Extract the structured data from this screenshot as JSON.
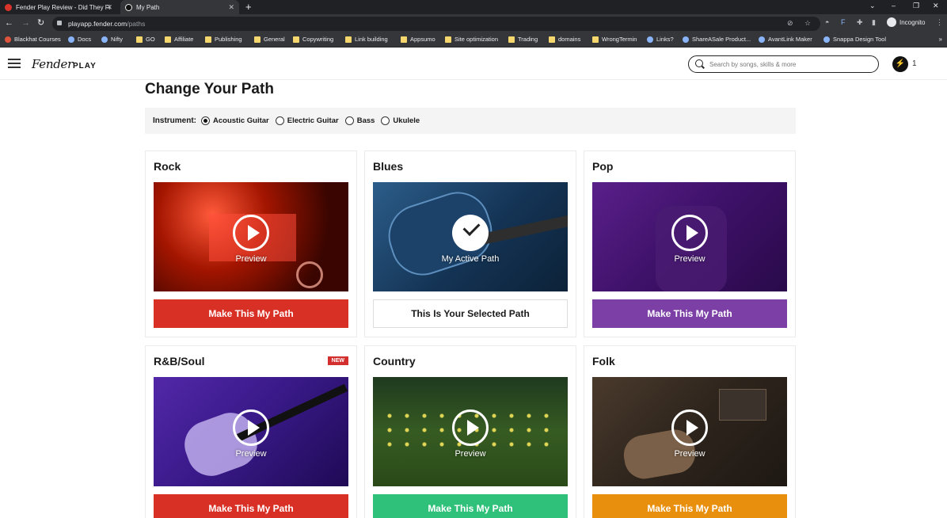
{
  "browser": {
    "tabs": [
      {
        "title": "Fender Play Review - Did They Fi"
      },
      {
        "title": "My Path"
      }
    ],
    "new_tab": "+",
    "url_host": "playapp.fender.com",
    "url_path": "/paths",
    "incognito_label": "Incognito",
    "window_controls": [
      "⌄",
      "–",
      "❐",
      "✕"
    ],
    "bookmarks": [
      {
        "label": "Blackhat Courses",
        "icon": "red"
      },
      {
        "label": "Docs",
        "icon": "site"
      },
      {
        "label": "Nifty",
        "icon": "site"
      },
      {
        "label": "GO",
        "icon": "folder"
      },
      {
        "label": "Affiliate",
        "icon": "folder"
      },
      {
        "label": "Publishing",
        "icon": "folder"
      },
      {
        "label": "General",
        "icon": "folder"
      },
      {
        "label": "Copywriting",
        "icon": "folder"
      },
      {
        "label": "Link building",
        "icon": "folder"
      },
      {
        "label": "Appsumo",
        "icon": "folder"
      },
      {
        "label": "Site optimization",
        "icon": "folder"
      },
      {
        "label": "Trading",
        "icon": "folder"
      },
      {
        "label": "domains",
        "icon": "folder"
      },
      {
        "label": "WrongTermin",
        "icon": "folder"
      },
      {
        "label": "Links?",
        "icon": "site"
      },
      {
        "label": "ShareASale Product...",
        "icon": "site"
      },
      {
        "label": "AvantLink Maker",
        "icon": "site"
      },
      {
        "label": "Snappa Design Tool",
        "icon": "site"
      }
    ],
    "bookmarks_more": "»"
  },
  "header": {
    "logo_script": "Fender",
    "logo_play": "PLAY",
    "search_placeholder": "Search by songs, skills & more",
    "streak_icon": "⚡",
    "streak_count": "1"
  },
  "page": {
    "title": "Change Your Path",
    "instrument_label": "Instrument:",
    "instruments": [
      {
        "label": "Acoustic Guitar",
        "selected": true
      },
      {
        "label": "Electric Guitar",
        "selected": false
      },
      {
        "label": "Bass",
        "selected": false
      },
      {
        "label": "Ukulele",
        "selected": false
      }
    ]
  },
  "paths": [
    {
      "title": "Rock",
      "caption": "Preview",
      "button": "Make This My Path",
      "color": "#d93025",
      "active": false,
      "badge": ""
    },
    {
      "title": "Blues",
      "caption": "My Active Path",
      "button": "This Is Your Selected Path",
      "color": "#ffffff",
      "active": true,
      "badge": ""
    },
    {
      "title": "Pop",
      "caption": "Preview",
      "button": "Make This My Path",
      "color": "#7b3fa6",
      "active": false,
      "badge": ""
    },
    {
      "title": "R&B/Soul",
      "caption": "Preview",
      "button": "Make This My Path",
      "color": "#d93025",
      "active": false,
      "badge": "NEW"
    },
    {
      "title": "Country",
      "caption": "Preview",
      "button": "Make This My Path",
      "color": "#2fc07a",
      "active": false,
      "badge": ""
    },
    {
      "title": "Folk",
      "caption": "Preview",
      "button": "Make This My Path",
      "color": "#e8900e",
      "active": false,
      "badge": ""
    }
  ]
}
